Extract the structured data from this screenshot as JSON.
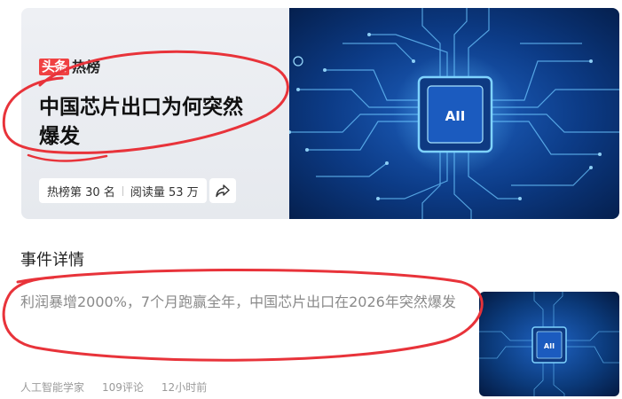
{
  "hot_card": {
    "brand_logo": "头条",
    "brand_label": "热榜",
    "title": "中国芯片出口为何突然爆发",
    "rank": "热榜第 30 名",
    "reads": "阅读量 53 万",
    "share_icon": "share-icon",
    "chip_label": "AII"
  },
  "event": {
    "section_title": "事件详情",
    "summary": "利润暴增2000%，7个月跑赢全年，中国芯片出口在2026年突然爆发",
    "thumb_chip_label": "AII",
    "author": "人工智能学家",
    "comments": "109评论",
    "time": "12小时前"
  },
  "colors": {
    "brand_red": "#f04142",
    "annotation_red": "#e8333a",
    "chip_blue": "#0b3a7a"
  }
}
